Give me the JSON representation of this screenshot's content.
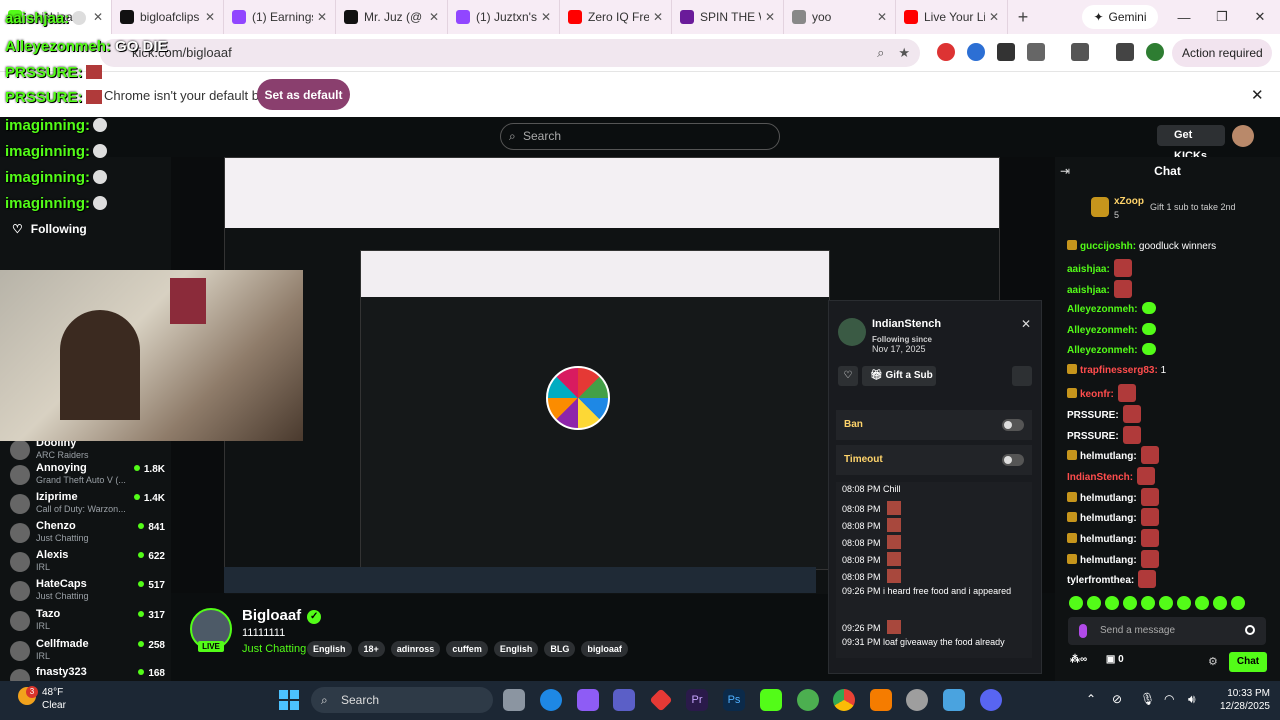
{
  "browser": {
    "tabs": [
      {
        "label": "aaishjaa",
        "color": "#53fc18",
        "active": true
      },
      {
        "label": "bigloafclips",
        "color": "#111"
      },
      {
        "label": "(1) Earnings",
        "color": "#9146ff"
      },
      {
        "label": "Mr. Juz (@",
        "color": "#111"
      },
      {
        "label": "(1) Juztxn's",
        "color": "#9146ff"
      },
      {
        "label": "Zero IQ Fre",
        "color": "#ff0000"
      },
      {
        "label": "SPIN THE W",
        "color": "#6a1b9a"
      },
      {
        "label": "yoo",
        "color": "#888"
      },
      {
        "label": "Live Your Li",
        "color": "#ff0000"
      }
    ],
    "gemini_label": "Gemini",
    "url": "kick.com/bigloaaf",
    "action_required": "Action required",
    "infobar_text": "Chrome isn't your default browser",
    "set_default": "Set as default"
  },
  "kick": {
    "search_placeholder": "Search",
    "get_kicks": "Get KICKs",
    "following": "Following",
    "sidebar": [
      {
        "name": "Dooliny",
        "game": "ARC Raiders",
        "viewers": ""
      },
      {
        "name": "Annoying",
        "game": "Grand Theft Auto V (...",
        "viewers": "1.8K"
      },
      {
        "name": "Iziprime",
        "game": "Call of Duty: Warzon...",
        "viewers": "1.4K"
      },
      {
        "name": "Chenzo",
        "game": "Just Chatting",
        "viewers": "841"
      },
      {
        "name": "Alexis",
        "game": "IRL",
        "viewers": "622"
      },
      {
        "name": "HateCaps",
        "game": "Just Chatting",
        "viewers": "517"
      },
      {
        "name": "Tazo",
        "game": "IRL",
        "viewers": "317"
      },
      {
        "name": "Cellfmade",
        "game": "IRL",
        "viewers": "258"
      },
      {
        "name": "fnasty323",
        "game": "",
        "viewers": "168"
      }
    ],
    "streamer": {
      "name": "Bigloaaf",
      "title": "11111111",
      "category": "Just Chatting",
      "live": "LIVE",
      "tags": [
        "English",
        "18+",
        "adinross",
        "cuffem",
        "English",
        "BLG",
        "bigloaaf"
      ]
    }
  },
  "overlay": [
    {
      "user": "aaishjaa:",
      "msg": ""
    },
    {
      "user": "Alleyezonmeh:",
      "msg": "GO DIE"
    },
    {
      "user": "PRSSURE:",
      "msg": ""
    },
    {
      "user": "PRSSURE:",
      "msg": ""
    },
    {
      "user": "imaginning:",
      "msg": ""
    },
    {
      "user": "imaginning:",
      "msg": ""
    },
    {
      "user": "imaginning:",
      "msg": ""
    },
    {
      "user": "imaginning:",
      "msg": ""
    }
  ],
  "popup": {
    "name": "IndianStench",
    "following_since": "Following since",
    "date": "Nov 17, 2025",
    "gift": "Gift a Sub",
    "ban": "Ban",
    "timeout": "Timeout",
    "history": [
      {
        "time": "08:08 PM",
        "text": "Chill"
      },
      {
        "time": "08:08 PM",
        "text": ""
      },
      {
        "time": "08:08 PM",
        "text": ""
      },
      {
        "time": "08:08 PM",
        "text": ""
      },
      {
        "time": "08:08 PM",
        "text": ""
      },
      {
        "time": "08:08 PM",
        "text": ""
      },
      {
        "time": "09:26 PM",
        "text": "i heard free food and i appeared"
      },
      {
        "time": "09:26 PM",
        "text": ""
      },
      {
        "time": "09:31 PM",
        "text": "loaf giveaway the food already"
      }
    ]
  },
  "chat": {
    "title": "Chat",
    "top_gifter": "xZoop",
    "top_gifter_count": "5",
    "gift_note": "Gift 1 sub to take 2nd",
    "messages": [
      {
        "user": "guccijoshh:",
        "msg": "goodluck winners",
        "color": "#53fc18",
        "emote": ""
      },
      {
        "user": "aaishjaa:",
        "msg": "",
        "color": "#53fc18",
        "emote": "red"
      },
      {
        "user": "aaishjaa:",
        "msg": "",
        "color": "#53fc18",
        "emote": "red"
      },
      {
        "user": "Alleyezonmeh:",
        "msg": "",
        "color": "#53fc18",
        "emote": "green"
      },
      {
        "user": "Alleyezonmeh:",
        "msg": "",
        "color": "#53fc18",
        "emote": "green"
      },
      {
        "user": "Alleyezonmeh:",
        "msg": "",
        "color": "#53fc18",
        "emote": "green"
      },
      {
        "user": "trapfinesserg83:",
        "msg": "1",
        "color": "#ff4d4d",
        "emote": ""
      },
      {
        "user": "keonfr:",
        "msg": "",
        "color": "#ff4d4d",
        "emote": "red"
      },
      {
        "user": "PRSSURE:",
        "msg": "",
        "color": "#ffffff",
        "emote": "red"
      },
      {
        "user": "PRSSURE:",
        "msg": "",
        "color": "#ffffff",
        "emote": "red"
      },
      {
        "user": "helmutlang:",
        "msg": "",
        "color": "#ffffff",
        "emote": "red"
      },
      {
        "user": "IndianStench:",
        "msg": "",
        "color": "#ff4d4d",
        "emote": "red"
      },
      {
        "user": "helmutlang:",
        "msg": "",
        "color": "#ffffff",
        "emote": "red"
      },
      {
        "user": "helmutlang:",
        "msg": "",
        "color": "#ffffff",
        "emote": "red"
      },
      {
        "user": "helmutlang:",
        "msg": "",
        "color": "#ffffff",
        "emote": "red"
      },
      {
        "user": "helmutlang:",
        "msg": "",
        "color": "#ffffff",
        "emote": "red"
      },
      {
        "user": "tylerfromthea:",
        "msg": "",
        "color": "#ffffff",
        "emote": "red"
      }
    ],
    "send_placeholder": "Send a message",
    "points": "0",
    "chat_button": "Chat"
  },
  "taskbar": {
    "weather_temp": "48°F",
    "weather_cond": "Clear",
    "weather_badge": "3",
    "search": "Search",
    "time": "10:33 PM",
    "date": "12/28/2025"
  }
}
